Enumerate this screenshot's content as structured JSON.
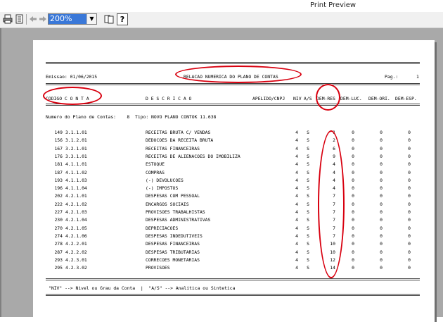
{
  "window": {
    "title": "Print Preview"
  },
  "toolbar": {
    "zoom_value": "200%",
    "help_label": "?"
  },
  "report": {
    "emissao": "Emissao: 01/06/2015",
    "title": "RELACAO NUMERICA DO PLANO DE CONTAS",
    "page_label": "Pag.:",
    "page_number": "1",
    "columns": {
      "codigo": "CODIGO C O N T A",
      "descricao": "D E S C R I C A O",
      "apelido": "APELIDO/CNPJ",
      "niv": "NIV",
      "as": "A/S",
      "dem_res": "DEM-RES",
      "dem_luc": "DEM-LUC.",
      "dem_ori": "DEM-ORI.",
      "dem_esp": "DEM-ESP."
    },
    "plan_line": "Numero do Plano de Contas:    8  Tipo: NOVO PLANO CONTOK 11.638",
    "rows": [
      {
        "num": "149",
        "code": "3.1.1.01",
        "desc": "RECEITAS BRUTA C/ VENDAS",
        "niv": "4",
        "as": "S",
        "res": "1",
        "luc": "0",
        "ori": "0",
        "esp": "0"
      },
      {
        "num": "156",
        "code": "3.1.2.01",
        "desc": "DEDUCOES DA RECEITA BRUTA",
        "niv": "4",
        "as": "S",
        "res": "2",
        "luc": "0",
        "ori": "0",
        "esp": "0"
      },
      {
        "num": "167",
        "code": "3.2.1.01",
        "desc": "RECEITAS FINANCEIRAS",
        "niv": "4",
        "as": "S",
        "res": "6",
        "luc": "0",
        "ori": "0",
        "esp": "0"
      },
      {
        "num": "176",
        "code": "3.3.1.01",
        "desc": "RECEITAS DE ALIENACOES DO IMOBILIZA",
        "niv": "4",
        "as": "S",
        "res": "9",
        "luc": "0",
        "ori": "0",
        "esp": "0"
      },
      {
        "num": "181",
        "code": "4.1.1.01",
        "desc": "ESTOQUE",
        "niv": "4",
        "as": "S",
        "res": "4",
        "luc": "0",
        "ori": "0",
        "esp": "0"
      },
      {
        "num": "187",
        "code": "4.1.1.02",
        "desc": "COMPRAS",
        "niv": "4",
        "as": "S",
        "res": "4",
        "luc": "0",
        "ori": "0",
        "esp": "0"
      },
      {
        "num": "193",
        "code": "4.1.1.03",
        "desc": "(-) DEVOLUCOES",
        "niv": "4",
        "as": "S",
        "res": "4",
        "luc": "0",
        "ori": "0",
        "esp": "0"
      },
      {
        "num": "196",
        "code": "4.1.1.04",
        "desc": "(-) IMPOSTOS",
        "niv": "4",
        "as": "S",
        "res": "4",
        "luc": "0",
        "ori": "0",
        "esp": "0"
      },
      {
        "num": "202",
        "code": "4.2.1.01",
        "desc": "DESPESAS COM PESSOAL",
        "niv": "4",
        "as": "S",
        "res": "7",
        "luc": "0",
        "ori": "0",
        "esp": "0"
      },
      {
        "num": "222",
        "code": "4.2.1.02",
        "desc": "ENCARGOS SOCIAIS",
        "niv": "4",
        "as": "S",
        "res": "7",
        "luc": "0",
        "ori": "0",
        "esp": "0"
      },
      {
        "num": "227",
        "code": "4.2.1.03",
        "desc": "PROVISOES TRABALHISTAS",
        "niv": "4",
        "as": "S",
        "res": "7",
        "luc": "0",
        "ori": "0",
        "esp": "0"
      },
      {
        "num": "230",
        "code": "4.2.1.04",
        "desc": "DESPESAS ADMINISTRATIVAS",
        "niv": "4",
        "as": "S",
        "res": "7",
        "luc": "0",
        "ori": "0",
        "esp": "0"
      },
      {
        "num": "270",
        "code": "4.2.1.05",
        "desc": "DEPRECIACOES",
        "niv": "4",
        "as": "S",
        "res": "7",
        "luc": "0",
        "ori": "0",
        "esp": "0"
      },
      {
        "num": "274",
        "code": "4.2.1.06",
        "desc": "DESPESAS INDEDUTIVEIS",
        "niv": "4",
        "as": "S",
        "res": "7",
        "luc": "0",
        "ori": "0",
        "esp": "0"
      },
      {
        "num": "278",
        "code": "4.2.2.01",
        "desc": "DESPESAS FINANCEIRAS",
        "niv": "4",
        "as": "S",
        "res": "10",
        "luc": "0",
        "ori": "0",
        "esp": "0"
      },
      {
        "num": "287",
        "code": "4.2.2.02",
        "desc": "DESPESAS TRIBUTARIAS",
        "niv": "4",
        "as": "S",
        "res": "10",
        "luc": "0",
        "ori": "0",
        "esp": "0"
      },
      {
        "num": "293",
        "code": "4.2.3.01",
        "desc": "CORRECOES MONETARIAS",
        "niv": "4",
        "as": "S",
        "res": "12",
        "luc": "0",
        "ori": "0",
        "esp": "0"
      },
      {
        "num": "295",
        "code": "4.2.3.02",
        "desc": "PROVISOES",
        "niv": "4",
        "as": "S",
        "res": "14",
        "luc": "0",
        "ori": "0",
        "esp": "0"
      }
    ],
    "footer": "\"NIV\" --> Nivel ou Grau da Conta  |  \"A/S\" --> Analitica ou Sintetica"
  },
  "colors": {
    "highlight_oval": "#d8000f",
    "workspace": "#a9a9a9",
    "zoom_selection": "#3a78d8"
  }
}
